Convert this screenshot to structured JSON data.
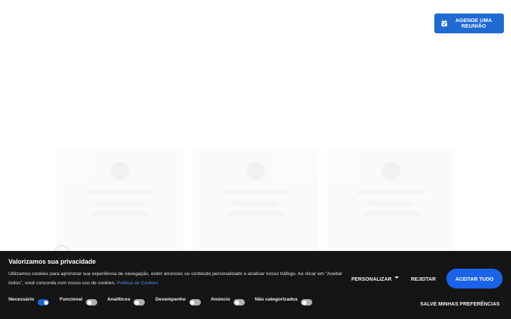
{
  "header": {
    "cta_label": "AGENDE UMA REUNIÃO",
    "cta_icon": "calendar-icon",
    "brand_color": "#1f6ad3"
  },
  "cookie_banner": {
    "title": "Valorizamos sua privacidade",
    "description": "Utilizamos cookies para aprimorar sua experiência de navegação, exibir anúncios ou conteúdo personalizado e analisar nosso tráfego. Ao clicar em \"Aceitar todos\", você concorda com nosso uso de cookies.",
    "policy_link": "Política de Cookies",
    "categories": [
      {
        "label": "Necessário",
        "enabled": true
      },
      {
        "label": "Funcional",
        "enabled": false
      },
      {
        "label": "Analíticos",
        "enabled": false
      },
      {
        "label": "Desempenho",
        "enabled": false
      },
      {
        "label": "Anúncio",
        "enabled": false
      },
      {
        "label": "Não categorizados",
        "enabled": false
      }
    ],
    "customize_label": "PERSONALIZAR",
    "reject_label": "REJEITAR",
    "accept_label": "ACEITAR TUDO",
    "save_label": "SALVE MINHAS PREFERÊNCIAS",
    "background_color": "#151515",
    "accent_color": "#1a63e8"
  }
}
